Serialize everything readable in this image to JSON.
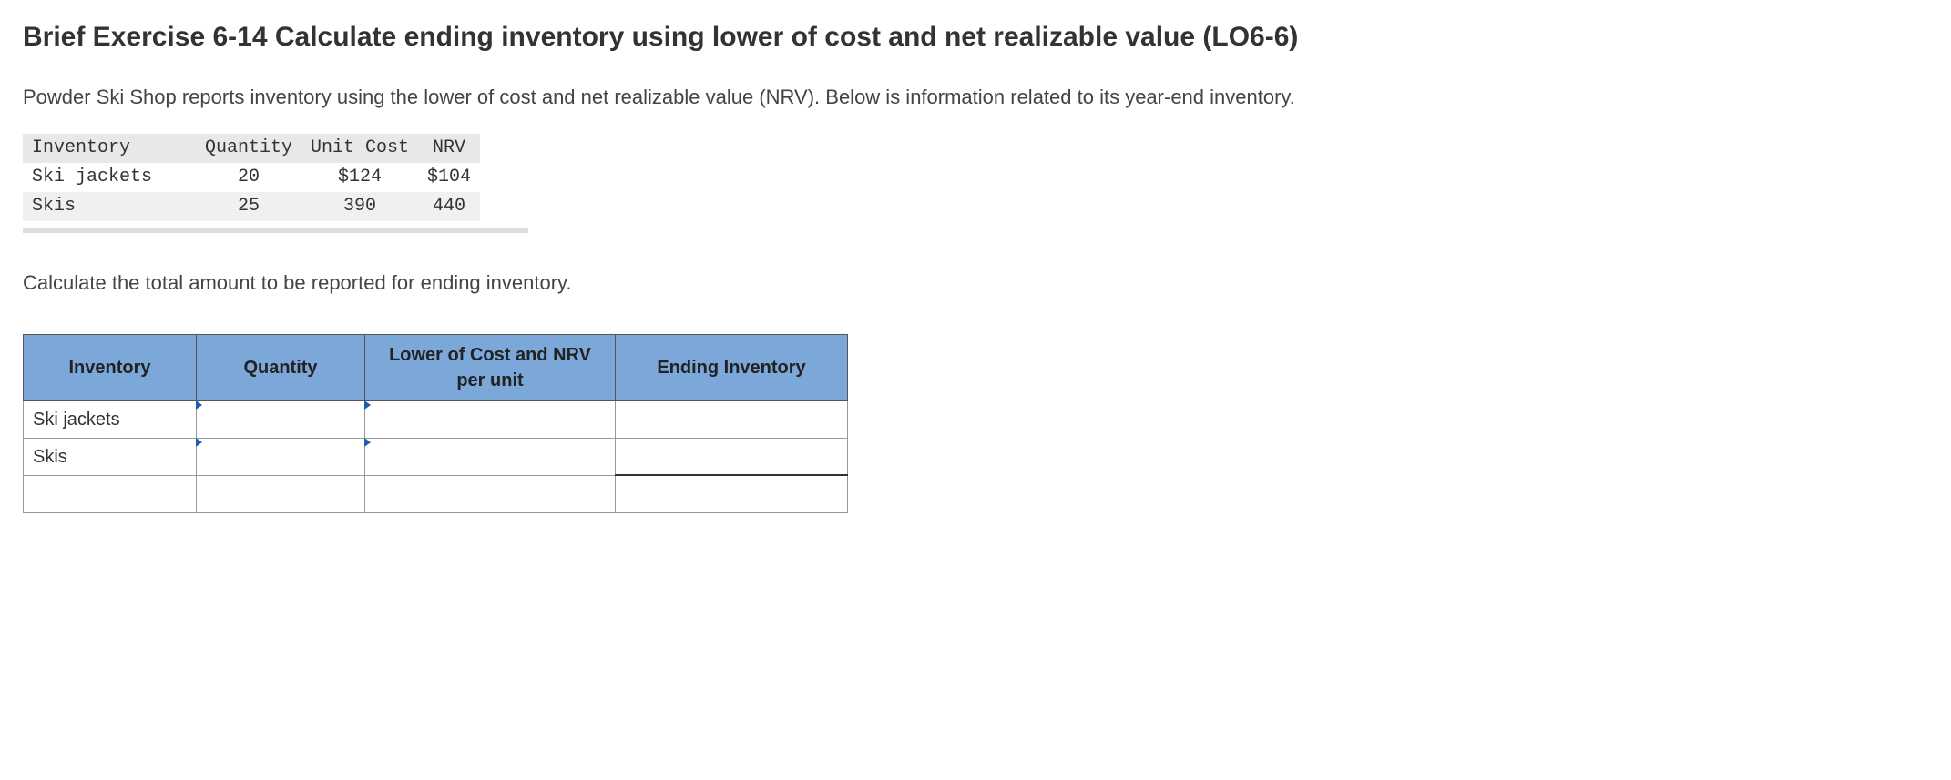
{
  "title": "Brief Exercise 6-14 Calculate ending inventory using lower of cost and net realizable value (LO6-6)",
  "intro": "Powder Ski Shop reports inventory using the lower of cost and net realizable value (NRV). Below is information related to its year-end inventory.",
  "given": {
    "headers": {
      "inv": "Inventory",
      "qty": "Quantity",
      "cost": "Unit Cost",
      "nrv": "NRV"
    },
    "rows": [
      {
        "inv": "Ski jackets",
        "qty": "20",
        "cost": "$124",
        "nrv": "$104"
      },
      {
        "inv": "Skis",
        "qty": "25",
        "cost": "390",
        "nrv": "440"
      }
    ]
  },
  "instruction": "Calculate the total amount to be reported for ending inventory.",
  "answer": {
    "headers": {
      "inv": "Inventory",
      "qty": "Quantity",
      "low": "Lower of Cost and NRV per unit",
      "end": "Ending Inventory"
    },
    "rows": [
      {
        "inv": "Ski jackets"
      },
      {
        "inv": "Skis"
      }
    ]
  }
}
